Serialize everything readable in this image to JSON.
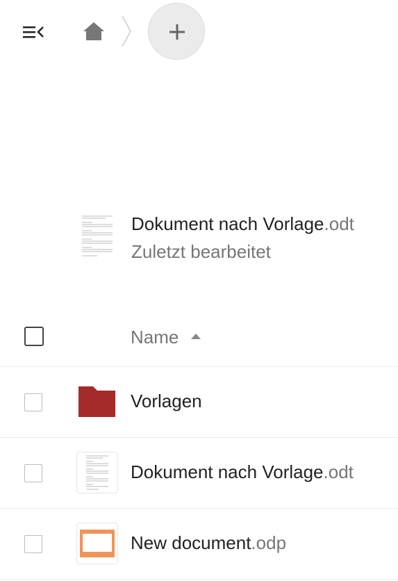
{
  "breadcrumb": {
    "home_icon": "home-icon",
    "add_icon": "plus-icon"
  },
  "recent": {
    "name": "Dokument nach Vorlage",
    "ext": ".odt",
    "subtitle": "Zuletzt bearbeitet"
  },
  "table": {
    "column_name": "Name",
    "sort_direction": "ascending"
  },
  "files": [
    {
      "name": "Vorlagen",
      "ext": "",
      "type": "folder",
      "color": "#a52a2a"
    },
    {
      "name": "Dokument nach Vorlage",
      "ext": ".odt",
      "type": "text-document"
    },
    {
      "name": "New document",
      "ext": ".odp",
      "type": "presentation",
      "color": "#f0955a"
    }
  ]
}
